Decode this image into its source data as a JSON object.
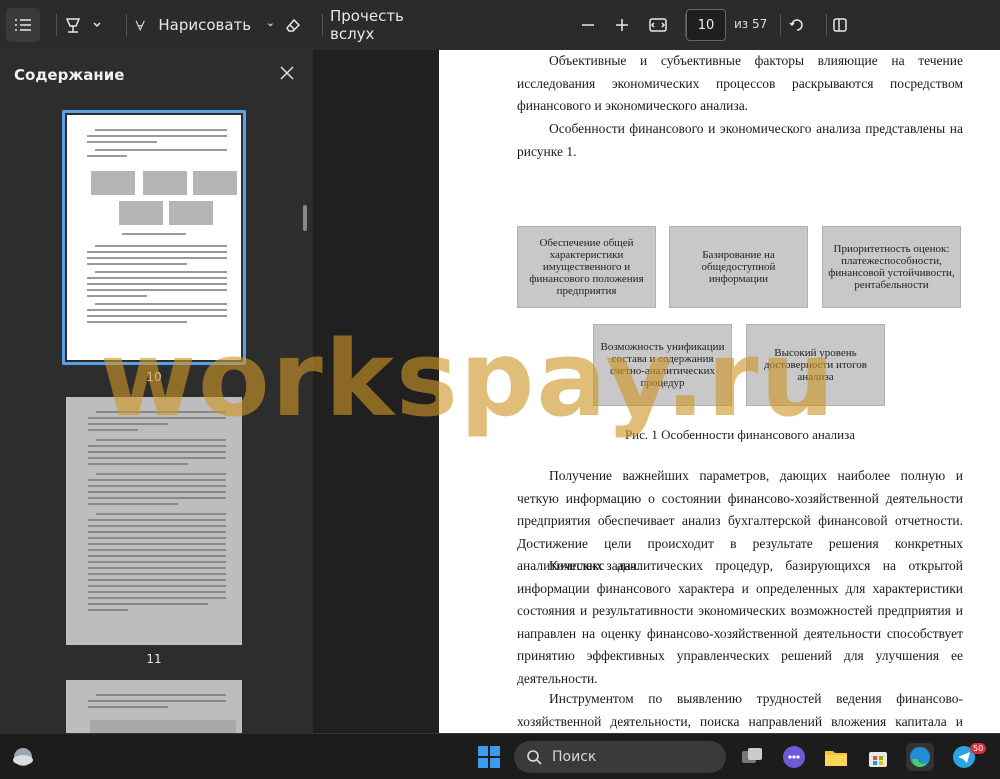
{
  "toolbar": {
    "draw_label": "Нарисовать",
    "read_aloud_label": "Прочесть вслух",
    "page_current": "10",
    "page_total_label": "из 57"
  },
  "sidebar": {
    "title": "Содержание",
    "thumbnails": [
      {
        "number": "10"
      },
      {
        "number": "11"
      }
    ]
  },
  "document": {
    "para1": "Объективные и субъективные факторы влияющие на течение исследования экономических процессов раскрываются посредством финансового и экономического анализа.",
    "para2": "Особенности финансового и экономического анализа представлены на рисунке 1.",
    "figure_boxes": {
      "b1": "Обеспечение общей характеристики имущественного и финансового положения предприятия",
      "b2": "Базирование на общедоступной информации",
      "b3": "Приоритетность оценок: платежеспособности, финансовой устойчивости, рентабельности",
      "b4": "Возможность унификации состава и содержания счетно-аналитических процедур",
      "b5": "Высокий уровень достоверности итогов анализа"
    },
    "caption": "Рис. 1 Особенности финансового анализа",
    "para3": "Получение важнейших параметров, дающих наиболее полную и четкую информацию о состоянии финансово-хозяйственной деятельности предприятия обеспечивает анализ бухгалтерской финансовой отчетности. Достижение цели происходит в результате решения конкретных аналитических задач.",
    "para4": "Комплекс аналитических процедур, базирующихся на открытой информации финансового характера и определенных для характеристики состояния и результативности экономических возможностей предприятия и направлен на оценку финансово-хозяйственной деятельности способствует принятию эффективных управленческих решений для улучшения ее деятельности.",
    "para5": "Инструментом по выявлению трудностей ведения финансово-хозяйственной деятельности, поиска направлений вложения капитала и прогнозирования обособленных показателей, планирования финансовой деятельности предприятия выступает анализ финансовой отчетности.",
    "page_number": "10"
  },
  "watermark": "workspay.ru",
  "taskbar": {
    "search_label": "Поиск",
    "badge_count": "50"
  },
  "colors": {
    "accent": "#4a9ee8",
    "watermark": "#cd9628"
  }
}
